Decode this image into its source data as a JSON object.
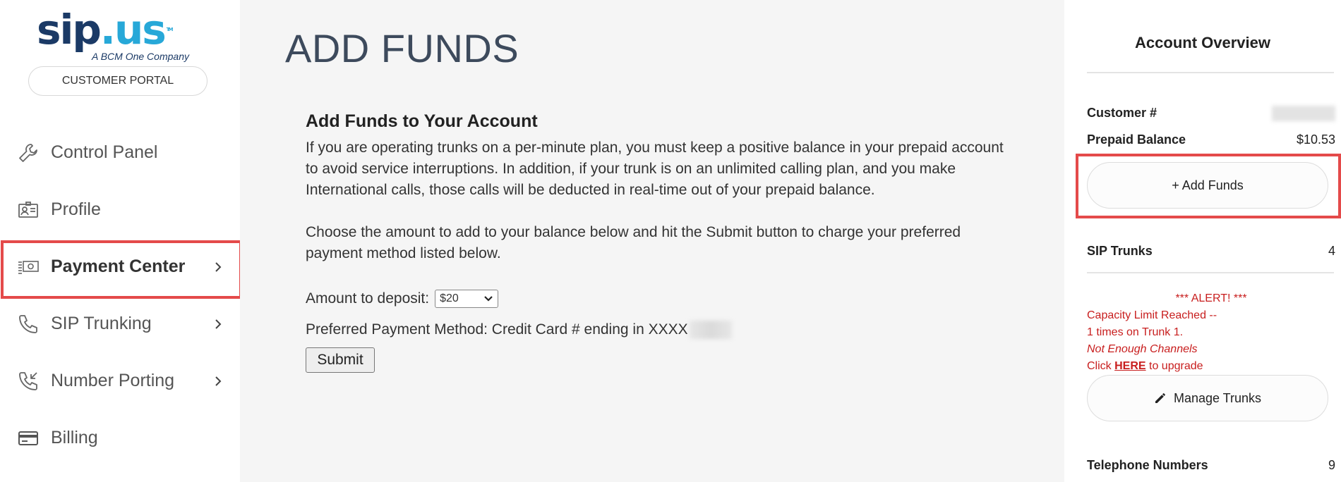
{
  "brand": {
    "logo_part_a": "sip",
    "logo_part_b": ".us",
    "logo_tm": "TM",
    "tagline": "A BCM One Company",
    "portal_label": "CUSTOMER PORTAL"
  },
  "sidebar": {
    "items": [
      {
        "label": "Control Panel",
        "icon": "wrench-icon",
        "chevron": false,
        "active": false
      },
      {
        "label": "Profile",
        "icon": "id-card-icon",
        "chevron": false,
        "active": false
      },
      {
        "label": "Payment Center",
        "icon": "money-icon",
        "chevron": true,
        "active": true
      },
      {
        "label": "SIP Trunking",
        "icon": "phone-icon",
        "chevron": true,
        "active": false
      },
      {
        "label": "Number Porting",
        "icon": "phone-incoming-icon",
        "chevron": true,
        "active": false
      },
      {
        "label": "Billing",
        "icon": "credit-card-icon",
        "chevron": false,
        "active": false
      }
    ]
  },
  "main": {
    "page_title": "ADD FUNDS",
    "section_title": "Add Funds to Your Account",
    "paragraph_1": "If you are operating trunks on a per-minute plan, you must keep a positive balance in your prepaid account to avoid service interruptions. In addition, if your trunk is on an unlimited calling plan, and you make International calls, those calls will be deducted in real-time out of your prepaid balance.",
    "paragraph_2": "Choose the amount to add to your balance below and hit the Submit button to charge your preferred payment method listed below.",
    "deposit_label": "Amount to deposit:",
    "deposit_value": "$20",
    "payment_method_label": "Preferred Payment Method: Credit Card # ending in XXXX",
    "submit_label": "Submit"
  },
  "overview": {
    "title": "Account Overview",
    "customer_label": "Customer #",
    "prepaid_label": "Prepaid Balance",
    "prepaid_value": "$10.53",
    "add_funds_label": "+ Add Funds",
    "sip_trunks_label": "SIP Trunks",
    "sip_trunks_value": "4",
    "alert": {
      "heading": "*** ALERT! ***",
      "line_1": "Capacity Limit Reached --",
      "line_2": "1 times on Trunk 1.",
      "line_3": "Not Enough Channels",
      "click_prefix": "Click ",
      "click_link": "HERE",
      "click_suffix": " to upgrade"
    },
    "manage_trunks_label": "Manage Trunks",
    "telephone_numbers_label": "Telephone Numbers",
    "telephone_numbers_value": "9"
  },
  "colors": {
    "highlight": "#e44a4a",
    "alert": "#c81e1e",
    "brand_dark": "#1b3a66",
    "brand_light": "#27a8d8"
  }
}
